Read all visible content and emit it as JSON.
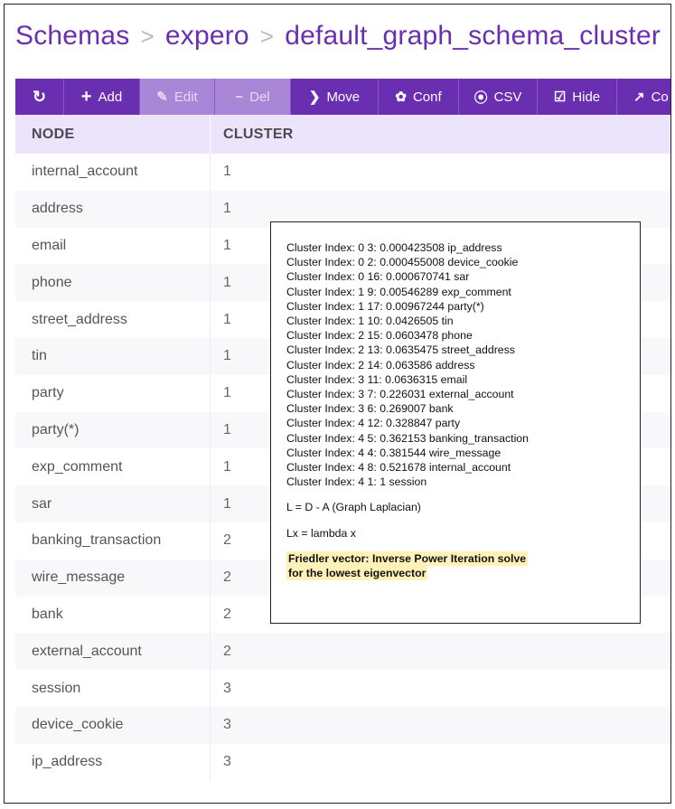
{
  "breadcrumb": {
    "root": "Schemas",
    "project": "expero",
    "schema": "default_graph_schema_cluster"
  },
  "toolbar": {
    "refresh_icon": "refresh-icon",
    "buttons": [
      {
        "icon": "+",
        "label": "Add",
        "enabled": true
      },
      {
        "icon": "✎",
        "label": "Edit",
        "enabled": false
      },
      {
        "icon": "−",
        "label": "Del",
        "enabled": false
      },
      {
        "icon": "❯",
        "label": "Move",
        "enabled": true
      },
      {
        "icon": "✿",
        "label": "Conf",
        "enabled": true
      },
      {
        "icon": "⦿",
        "label": "CSV",
        "enabled": true
      },
      {
        "icon": "☑",
        "label": "Hide",
        "enabled": true
      },
      {
        "icon": "↗",
        "label": "Co",
        "enabled": true
      }
    ]
  },
  "table": {
    "headers": [
      "NODE",
      "CLUSTER"
    ],
    "rows": [
      [
        "internal_account",
        "1"
      ],
      [
        "address",
        "1"
      ],
      [
        "email",
        "1"
      ],
      [
        "phone",
        "1"
      ],
      [
        "street_address",
        "1"
      ],
      [
        "tin",
        "1"
      ],
      [
        "party",
        "1"
      ],
      [
        "party(*)",
        "1"
      ],
      [
        "exp_comment",
        "1"
      ],
      [
        "sar",
        "1"
      ],
      [
        "banking_transaction",
        "2"
      ],
      [
        "wire_message",
        "2"
      ],
      [
        "bank",
        "2"
      ],
      [
        "external_account",
        "2"
      ],
      [
        "session",
        "3"
      ],
      [
        "device_cookie",
        "3"
      ],
      [
        "ip_address",
        "3"
      ]
    ]
  },
  "overlay": {
    "cluster_lines": [
      "Cluster Index: 0 3: 0.000423508 ip_address",
      "Cluster Index: 0 2: 0.000455008 device_cookie",
      "Cluster Index: 0 16: 0.000670741 sar",
      "Cluster Index: 1 9: 0.00546289 exp_comment",
      "Cluster Index: 1 17: 0.00967244 party(*)",
      "Cluster Index: 1 10: 0.0426505 tin",
      "Cluster Index: 2 15: 0.0603478 phone",
      "Cluster Index: 2 13: 0.0635475 street_address",
      "Cluster Index: 2 14: 0.063586 address",
      "Cluster Index: 3 11: 0.0636315 email",
      "Cluster Index: 3 7: 0.226031 external_account",
      "Cluster Index: 3 6: 0.269007 bank",
      "Cluster Index: 4 12: 0.328847 party",
      "Cluster Index: 4 5: 0.362153 banking_transaction",
      "Cluster Index: 4 4: 0.381544 wire_message",
      "Cluster Index: 4 8: 0.521678 internal_account",
      "Cluster Index: 4 1: 1 session"
    ],
    "laplacian": "L = D - A (Graph Laplacian)",
    "eigen": "Lx = lambda x",
    "highlight_line1": "Friedler vector: Inverse Power Iteration solve",
    "highlight_line2": "for the lowest eigenvector"
  }
}
